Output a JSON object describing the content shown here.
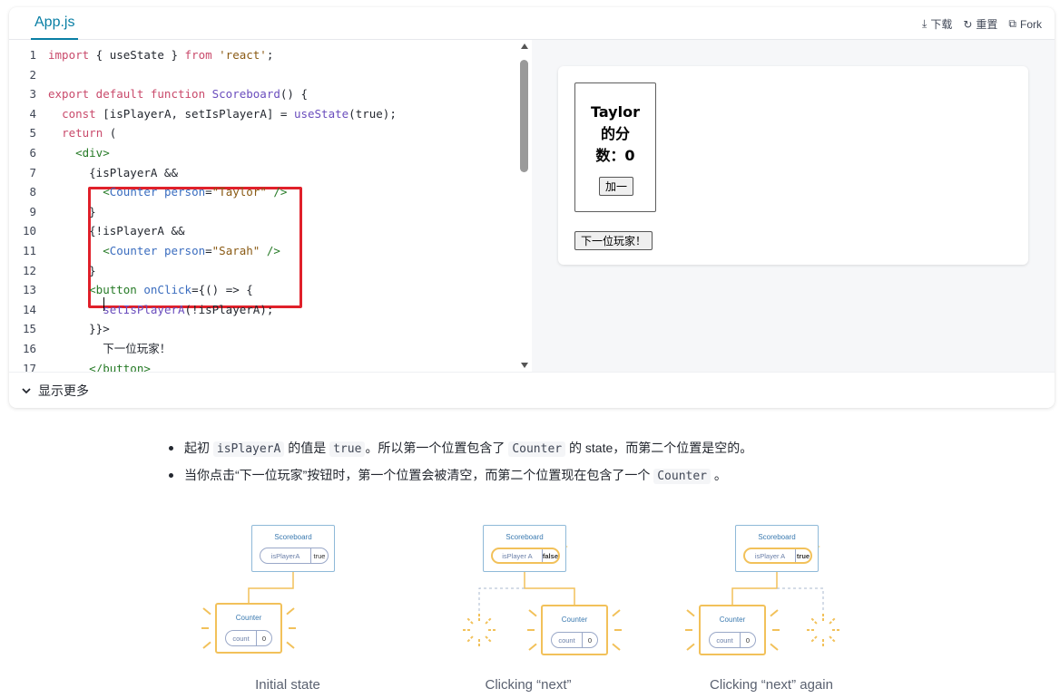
{
  "sandpack": {
    "tab": "App.js",
    "actions": [
      {
        "label": "下载",
        "icon": "download-icon"
      },
      {
        "label": "重置",
        "icon": "reset-icon"
      },
      {
        "label": "Fork",
        "icon": "external-link-icon"
      }
    ],
    "code_lines": [
      {
        "n": "1",
        "tokens": [
          [
            "kw",
            "import"
          ],
          [
            "plain",
            " { useState } "
          ],
          [
            "kw",
            "from"
          ],
          [
            "plain",
            " "
          ],
          [
            "str",
            "'react'"
          ],
          [
            "plain",
            ";"
          ]
        ]
      },
      {
        "n": "2",
        "tokens": []
      },
      {
        "n": "3",
        "tokens": [
          [
            "kw",
            "export default function "
          ],
          [
            "fn",
            "Scoreboard"
          ],
          [
            "plain",
            "() {"
          ]
        ]
      },
      {
        "n": "4",
        "tokens": [
          [
            "plain",
            "  "
          ],
          [
            "kw",
            "const"
          ],
          [
            "plain",
            " [isPlayerA, setIsPlayerA] = "
          ],
          [
            "fn",
            "useState"
          ],
          [
            "plain",
            "(true);"
          ]
        ]
      },
      {
        "n": "5",
        "tokens": [
          [
            "plain",
            "  "
          ],
          [
            "kw",
            "return"
          ],
          [
            "plain",
            " ("
          ]
        ]
      },
      {
        "n": "6",
        "tokens": [
          [
            "plain",
            "    "
          ],
          [
            "tag",
            "<div>"
          ]
        ]
      },
      {
        "n": "7",
        "tokens": [
          [
            "plain",
            "      {isPlayerA &&"
          ]
        ]
      },
      {
        "n": "8",
        "tokens": [
          [
            "plain",
            "        "
          ],
          [
            "tag",
            "<"
          ],
          [
            "cmp",
            "Counter"
          ],
          [
            "plain",
            " "
          ],
          [
            "attr",
            "person"
          ],
          [
            "plain",
            "="
          ],
          [
            "str",
            "\"Taylor\""
          ],
          [
            "plain",
            " "
          ],
          [
            "tag",
            "/>"
          ]
        ]
      },
      {
        "n": "9",
        "tokens": [
          [
            "plain",
            "      }"
          ]
        ]
      },
      {
        "n": "10",
        "tokens": [
          [
            "plain",
            "      {!isPlayerA &&"
          ]
        ]
      },
      {
        "n": "11",
        "tokens": [
          [
            "plain",
            "        "
          ],
          [
            "tag",
            "<"
          ],
          [
            "cmp",
            "Counter"
          ],
          [
            "plain",
            " "
          ],
          [
            "attr",
            "person"
          ],
          [
            "plain",
            "="
          ],
          [
            "str",
            "\"Sarah\""
          ],
          [
            "plain",
            " "
          ],
          [
            "tag",
            "/>"
          ]
        ]
      },
      {
        "n": "12",
        "tokens": [
          [
            "plain",
            "      }"
          ]
        ]
      },
      {
        "n": "13",
        "tokens": [
          [
            "plain",
            "      "
          ],
          [
            "tag",
            "<button "
          ],
          [
            "attr",
            "onClick"
          ],
          [
            "plain",
            "={() => {"
          ]
        ]
      },
      {
        "n": "14",
        "tokens": [
          [
            "plain",
            "        "
          ],
          [
            "fn",
            "setIsPlayerA"
          ],
          [
            "plain",
            "(!isPlayerA);"
          ]
        ]
      },
      {
        "n": "15",
        "tokens": [
          [
            "plain",
            "      }}>"
          ]
        ]
      },
      {
        "n": "16",
        "tokens": [
          [
            "plain",
            "        下一位玩家！"
          ]
        ]
      },
      {
        "n": "17",
        "tokens": [
          [
            "plain",
            "      "
          ],
          [
            "tag",
            "</button>"
          ]
        ]
      }
    ],
    "preview": {
      "counter_title": "Taylor 的分数：0",
      "counter_title_lines": [
        "Taylor",
        "的分",
        "数：0"
      ],
      "add_button": "加一",
      "next_button": "下一位玩家！"
    },
    "show_more": "显示更多"
  },
  "bullets": [
    {
      "parts": [
        [
          "t",
          "起初 "
        ],
        [
          "c",
          "isPlayerA"
        ],
        [
          "t",
          " 的值是 "
        ],
        [
          "c",
          "true"
        ],
        [
          "t",
          "。所以第一个位置包含了 "
        ],
        [
          "c",
          "Counter"
        ],
        [
          "t",
          " 的 state，而第二个位置是空的。"
        ]
      ]
    },
    {
      "parts": [
        [
          "t",
          "当你点击“下一位玩家”按钮时，第一个位置会被清空，而第二个位置现在包含了一个 "
        ],
        [
          "c",
          "Counter"
        ],
        [
          "t",
          " 。"
        ]
      ]
    }
  ],
  "diagrams": [
    {
      "label": "Initial state",
      "scoreboard_title": "Scoreboard",
      "state_key": "isPlayerA",
      "state_value": "true",
      "counter_title": "Counter",
      "count_key": "count",
      "count_value": "0"
    },
    {
      "label": "Clicking “next”",
      "scoreboard_title": "Scoreboard",
      "state_key": "isPlayer A",
      "state_value": "false",
      "counter_title": "Counter",
      "count_key": "count",
      "count_value": "0"
    },
    {
      "label": "Clicking “next” again",
      "scoreboard_title": "Scoreboard",
      "state_key": "isPlayer A",
      "state_value": "true",
      "counter_title": "Counter",
      "count_key": "count",
      "count_value": "0"
    }
  ],
  "colors": {
    "accent": "#087ea4",
    "highlight": "#e0202a",
    "counter_border": "#f2c15a"
  }
}
